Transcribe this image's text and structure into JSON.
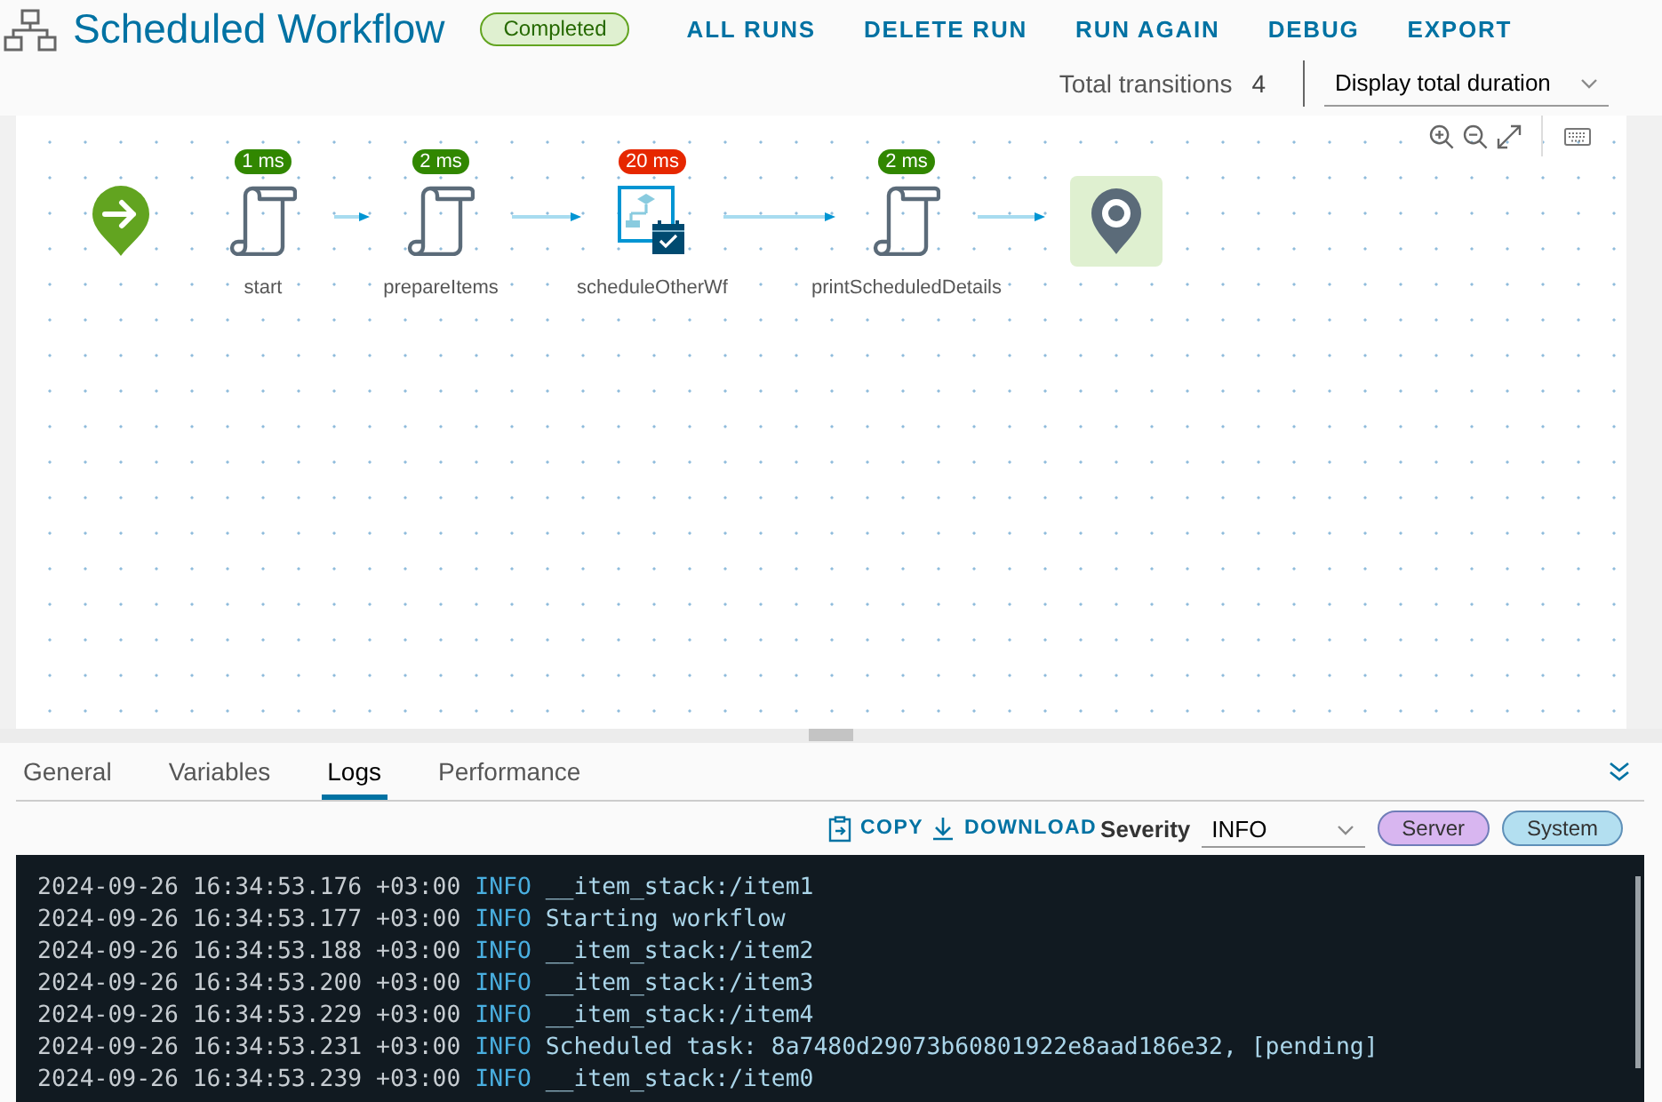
{
  "header": {
    "title": "Scheduled Workflow",
    "status": "Completed",
    "actions": [
      "ALL RUNS",
      "DELETE RUN",
      "RUN AGAIN",
      "DEBUG",
      "EXPORT"
    ]
  },
  "summary": {
    "label": "Total transitions",
    "value": "4",
    "display_select": "Display total duration"
  },
  "canvas": {
    "nodes": [
      {
        "kind": "start"
      },
      {
        "kind": "script",
        "label": "start",
        "duration": {
          "text": "1 ms",
          "color": "#318700"
        }
      },
      {
        "kind": "script",
        "label": "prepareItems",
        "duration": {
          "text": "2 ms",
          "color": "#318700"
        }
      },
      {
        "kind": "workflow",
        "label": "scheduleOtherWf",
        "duration": {
          "text": "20 ms",
          "color": "#e62700"
        }
      },
      {
        "kind": "script",
        "label": "printScheduledDetails",
        "duration": {
          "text": "2 ms",
          "color": "#318700"
        }
      },
      {
        "kind": "end"
      }
    ]
  },
  "tabs": [
    {
      "label": "General",
      "selected": false
    },
    {
      "label": "Variables",
      "selected": false
    },
    {
      "label": "Logs",
      "selected": true
    },
    {
      "label": "Performance",
      "selected": false
    }
  ],
  "logs": {
    "actions": [
      {
        "kind": "copy",
        "label": "COPY"
      },
      {
        "kind": "download",
        "label": "DOWNLOAD"
      }
    ],
    "severity": {
      "label": "Severity",
      "value": "INFO"
    },
    "filters": [
      {
        "label": "Server",
        "color": "#d8b6f0"
      },
      {
        "label": "System",
        "color": "#b3dff0"
      }
    ],
    "lines": [
      {
        "timestamp": "2024-09-26 16:34:53.176 +03:00",
        "level": "INFO",
        "message": "__item_stack:/item1"
      },
      {
        "timestamp": "2024-09-26 16:34:53.177 +03:00",
        "level": "INFO",
        "message": "Starting workflow"
      },
      {
        "timestamp": "2024-09-26 16:34:53.188 +03:00",
        "level": "INFO",
        "message": "__item_stack:/item2"
      },
      {
        "timestamp": "2024-09-26 16:34:53.200 +03:00",
        "level": "INFO",
        "message": "__item_stack:/item3"
      },
      {
        "timestamp": "2024-09-26 16:34:53.229 +03:00",
        "level": "INFO",
        "message": "__item_stack:/item4"
      },
      {
        "timestamp": "2024-09-26 16:34:53.231 +03:00",
        "level": "INFO",
        "message": "Scheduled task: 8a7480d29073b60801922e8aad186e32, [pending]"
      },
      {
        "timestamp": "2024-09-26 16:34:53.239 +03:00",
        "level": "INFO",
        "message": "__item_stack:/item0"
      }
    ]
  }
}
